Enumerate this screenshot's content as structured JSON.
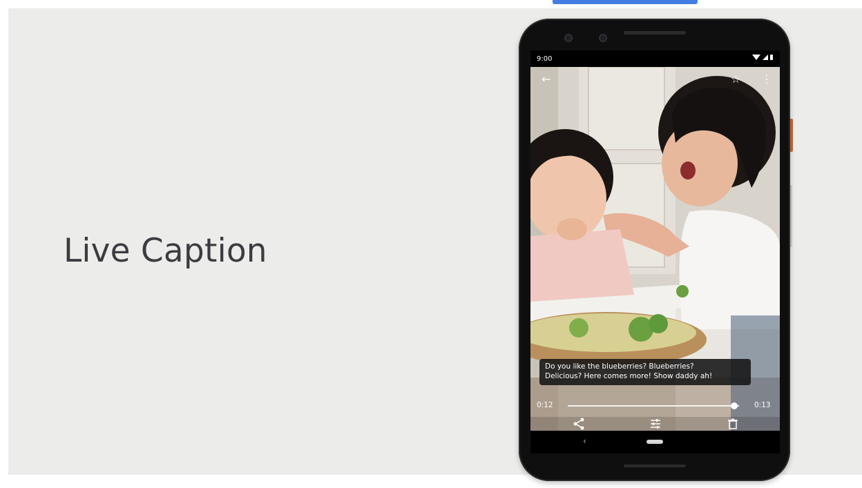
{
  "slide": {
    "headline": "Live Caption"
  },
  "phone": {
    "status_time": "9:00",
    "caption_lines": [
      "Do you like the blueberries? Blueberries?",
      "Delicious? Here comes more! Show daddy ah!"
    ],
    "seek_current": "0:12",
    "seek_total": "0:13",
    "seek_progress": 0.97,
    "icons": {
      "back": "arrow-left-icon",
      "favorite": "star-outline-icon",
      "more": "more-vert-icon",
      "share": "share-icon",
      "edit": "tune-icon",
      "delete": "trash-icon"
    }
  },
  "colors": {
    "slide_background": "#ecedea",
    "headline": "#3a3c3f",
    "phone_body": "#0f0f10",
    "power_button": "#c46a3c"
  }
}
